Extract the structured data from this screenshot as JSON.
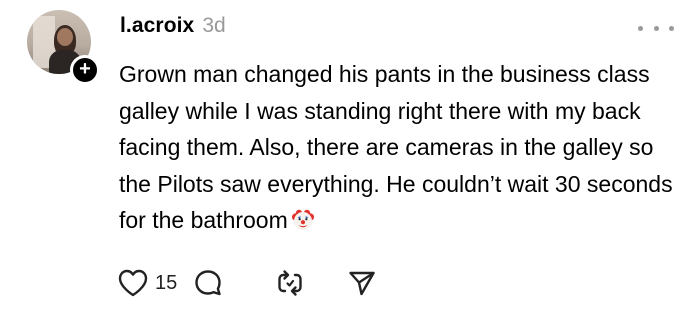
{
  "post": {
    "username": "l.acroix",
    "timestamp": "3d",
    "text": "Grown man changed his pants in the business class galley while I was standing right there with my back facing them. Also, there are cameras in the galley so the Pilots saw everything. He couldn’t wait 30 seconds for the bathroom",
    "trailing_emoji": "clown-face",
    "follow_badge": "+",
    "more_icon": "more-horizontal-icon"
  },
  "actions": {
    "like_count": "15",
    "icons": [
      "heart-icon",
      "comment-icon",
      "repost-icon",
      "share-icon"
    ]
  }
}
